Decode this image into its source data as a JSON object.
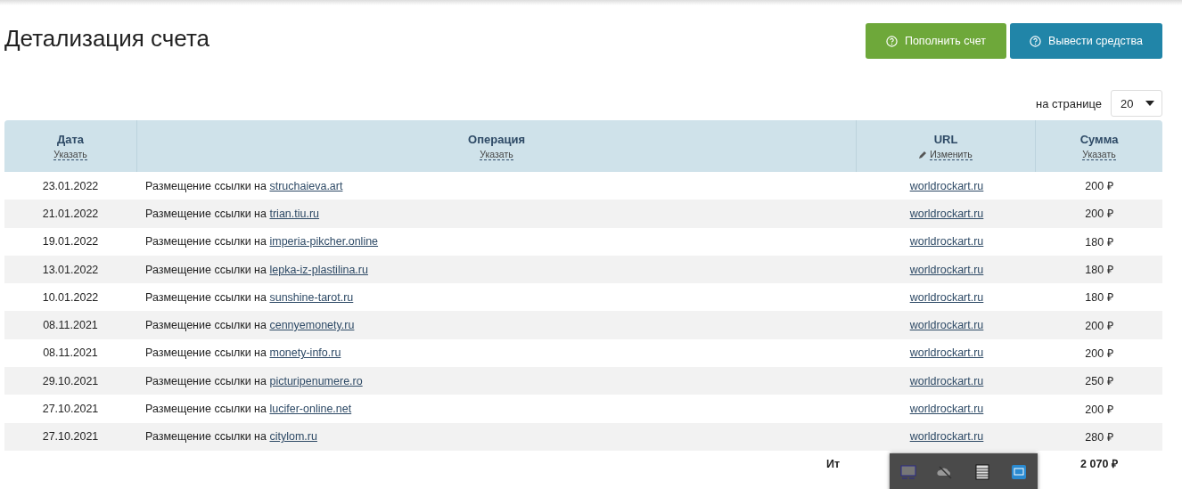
{
  "page_title": "Детализация счета",
  "actions": [
    {
      "label": "Пополнить счет",
      "kind": "topup"
    },
    {
      "label": "Вывести средства",
      "kind": "withdraw"
    }
  ],
  "per_page": {
    "label": "на странице",
    "value": "20"
  },
  "table": {
    "columns": [
      {
        "title": "Дата",
        "action": "Указать",
        "edit_icon": false
      },
      {
        "title": "Операция",
        "action": "Указать",
        "edit_icon": false
      },
      {
        "title": "URL",
        "action": "Изменить",
        "edit_icon": true
      },
      {
        "title": "Сумма",
        "action": "Указать",
        "edit_icon": false
      }
    ],
    "rows": [
      {
        "date": "23.01.2022",
        "operation": "Размещение ссылки на",
        "site": "struchaieva.art",
        "url": "worldrockart.ru",
        "amount": "200 ₽"
      },
      {
        "date": "21.01.2022",
        "operation": "Размещение ссылки на",
        "site": "trian.tiu.ru",
        "url": "worldrockart.ru",
        "amount": "200 ₽"
      },
      {
        "date": "19.01.2022",
        "operation": "Размещение ссылки на",
        "site": "imperia-pikcher.online",
        "url": "worldrockart.ru",
        "amount": "180 ₽"
      },
      {
        "date": "13.01.2022",
        "operation": "Размещение ссылки на",
        "site": "lepka-iz-plastilina.ru",
        "url": "worldrockart.ru",
        "amount": "180 ₽"
      },
      {
        "date": "10.01.2022",
        "operation": "Размещение ссылки на",
        "site": "sunshine-tarot.ru",
        "url": "worldrockart.ru",
        "amount": "180 ₽"
      },
      {
        "date": "08.11.2021",
        "operation": "Размещение ссылки на",
        "site": "cennyemonety.ru",
        "url": "worldrockart.ru",
        "amount": "200 ₽"
      },
      {
        "date": "08.11.2021",
        "operation": "Размещение ссылки на",
        "site": "monety-info.ru",
        "url": "worldrockart.ru",
        "amount": "200 ₽"
      },
      {
        "date": "29.10.2021",
        "operation": "Размещение ссылки на",
        "site": "picturipenumere.ro",
        "url": "worldrockart.ru",
        "amount": "250 ₽"
      },
      {
        "date": "27.10.2021",
        "operation": "Размещение ссылки на",
        "site": "lucifer-online.net",
        "url": "worldrockart.ru",
        "amount": "200 ₽"
      },
      {
        "date": "27.10.2021",
        "operation": "Размещение ссылки на",
        "site": "citylom.ru",
        "url": "worldrockart.ru",
        "amount": "280 ₽"
      }
    ],
    "total_label": "Ит",
    "total": "2 070 ₽"
  }
}
